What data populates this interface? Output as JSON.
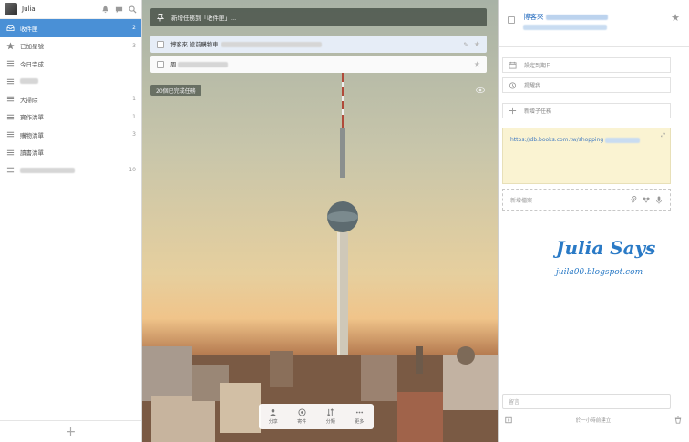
{
  "user": {
    "name": "Julia"
  },
  "sidebar": {
    "items": [
      {
        "label": "收件匣",
        "count": "2",
        "icon": "inbox-icon",
        "active": true
      },
      {
        "label": "已加星號",
        "count": "3",
        "icon": "star-icon"
      },
      {
        "label": "今日完成",
        "count": "",
        "icon": "list-icon"
      },
      {
        "label": "",
        "count": "",
        "icon": "list-icon",
        "blurred": true
      },
      {
        "label": "大掃除",
        "count": "1",
        "icon": "list-icon"
      },
      {
        "label": "寶作清單",
        "count": "1",
        "icon": "list-icon"
      },
      {
        "label": "購物清單",
        "count": "3",
        "icon": "list-icon"
      },
      {
        "label": "讀書清單",
        "count": "",
        "icon": "list-icon"
      },
      {
        "label": "",
        "count": "10",
        "icon": "list-icon",
        "blurred": true
      }
    ],
    "add_label": "+"
  },
  "main": {
    "add_placeholder": "新增任務到「收件匣」...",
    "tasks": [
      {
        "title": "博客來 搶前購物車"
      },
      {
        "title": "周"
      }
    ],
    "completed_label": "20個已完成任務",
    "toolbar": [
      {
        "label": "分享",
        "icon": "share-icon"
      },
      {
        "label": "寄件",
        "icon": "mail-icon"
      },
      {
        "label": "分類",
        "icon": "sort-icon"
      },
      {
        "label": "更多",
        "icon": "more-icon"
      }
    ]
  },
  "detail": {
    "title": "博客來",
    "due_label": "設定到期日",
    "reminder_label": "提醒我",
    "subtask_label": "新增子任務",
    "note_url": "https://db.books.com.tw/shopping",
    "file_label": "新增檔案",
    "comment_placeholder": "留言",
    "created_label": "於一小時前建立"
  },
  "watermark": {
    "title": "Julia Says",
    "subtitle": "juila00.blogspot.com"
  },
  "colors": {
    "accent": "#4a90d6",
    "link": "#2a6fc0",
    "note_bg": "#faf3d2"
  }
}
